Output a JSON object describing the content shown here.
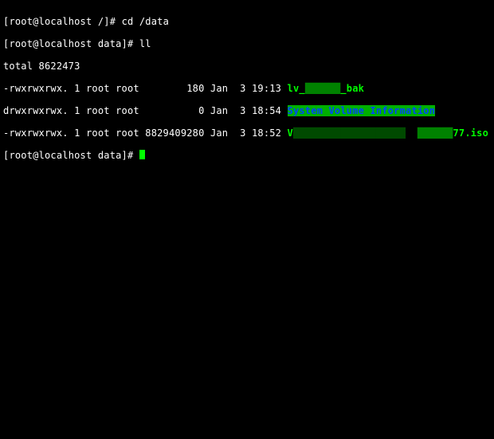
{
  "prompt1": {
    "user": "root",
    "host": "localhost",
    "cwd": "/",
    "sep": "#",
    "cmd": "cd /data"
  },
  "prompt2": {
    "user": "root",
    "host": "localhost",
    "cwd": "data",
    "sep": "#",
    "cmd": "ll"
  },
  "total_line": "total 8622473",
  "listing": [
    {
      "perm": "-rwxrwxrwx.",
      "links": "1",
      "owner": "root",
      "group": "root",
      "size": "180",
      "month": "Jan",
      "day": "3",
      "time": "19:13",
      "name_pre": "lv_",
      "redact_mid": "██████",
      "name_post": "_bak",
      "type": "file_green"
    },
    {
      "perm": "drwxrwxrwx.",
      "links": "1",
      "owner": "root",
      "group": "root",
      "size": "0",
      "month": "Jan",
      "day": "3",
      "time": "18:54",
      "dir_name": "System Volume Information",
      "type": "dir"
    },
    {
      "perm": "-rwxrwxrwx.",
      "links": "1",
      "owner": "root",
      "group": "root",
      "size": "8829409280",
      "month": "Jan",
      "day": "3",
      "time": "18:52",
      "name_pre": "V",
      "redact_mid": "███████████████████",
      "redact_mid2": "██████",
      "name_post": "77.iso",
      "type": "file_green"
    }
  ],
  "prompt3": {
    "user": "root",
    "host": "localhost",
    "cwd": "data",
    "sep": "#"
  }
}
